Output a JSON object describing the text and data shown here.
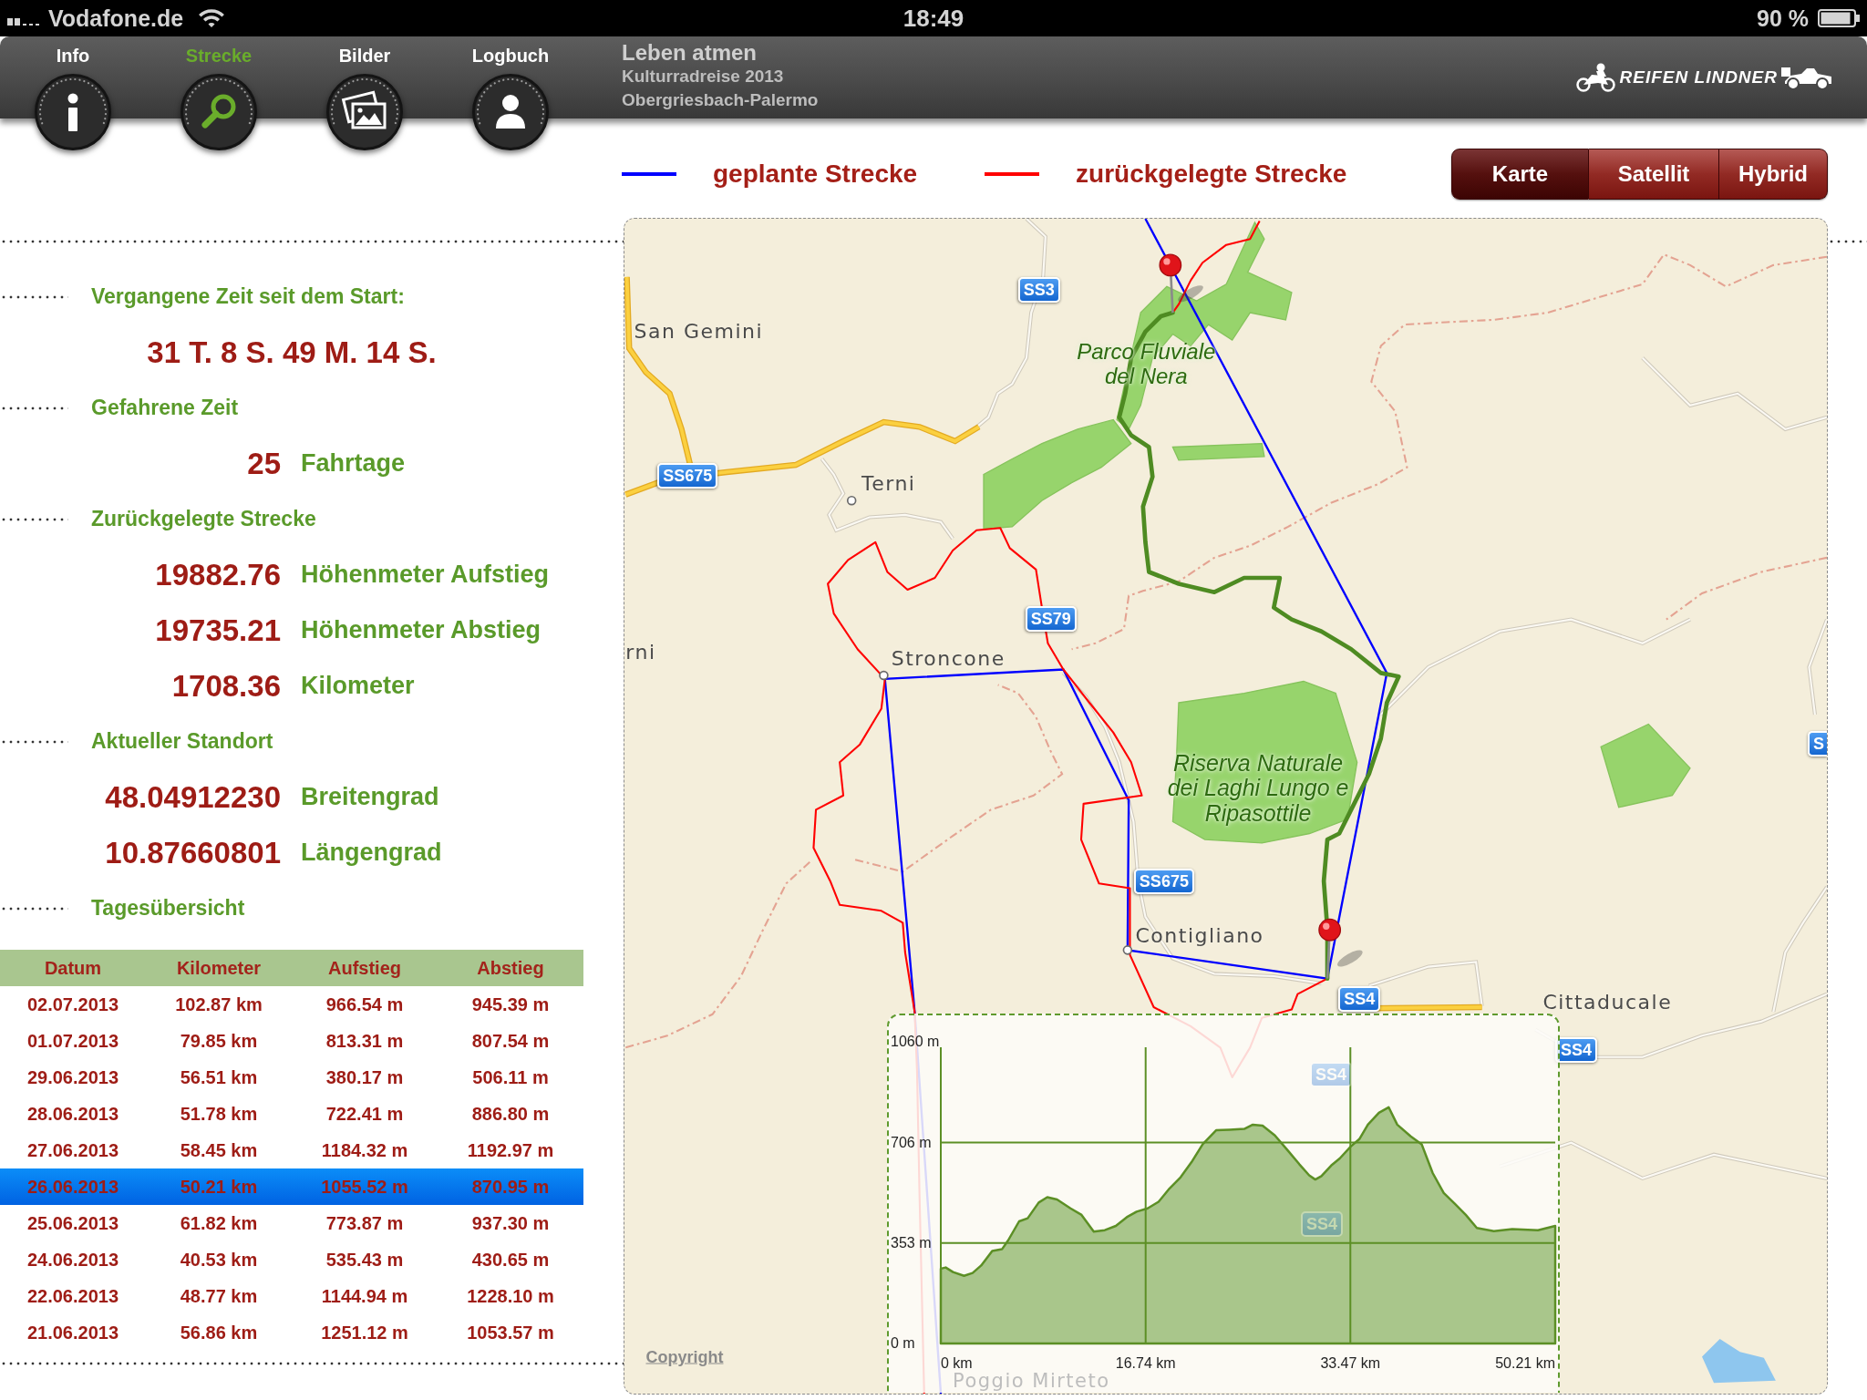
{
  "status_bar": {
    "carrier": "Vodafone.de",
    "time": "18:49",
    "battery": "90 %"
  },
  "nav": {
    "tabs": [
      {
        "label": "Info",
        "kind": "info",
        "selected": false
      },
      {
        "label": "Strecke",
        "kind": "route",
        "selected": true
      },
      {
        "label": "Bilder",
        "kind": "pictures",
        "selected": false
      },
      {
        "label": "Logbuch",
        "kind": "logbook",
        "selected": false
      }
    ],
    "title": "Leben atmen",
    "subtitle": "Kulturradreise 2013",
    "route": "Obergriesbach-Palermo",
    "logo": "REIFEN LINDNER"
  },
  "legend": [
    {
      "label": "geplante Strecke",
      "color": "#0000ff"
    },
    {
      "label": "zurückgelegte Strecke",
      "color": "#ff0000"
    }
  ],
  "map_type": [
    {
      "label": "Karte",
      "selected": true
    },
    {
      "label": "Satellit",
      "selected": false
    },
    {
      "label": "Hybrid",
      "selected": false
    }
  ],
  "stats": [
    {
      "heading": "Vergangene Zeit seit dem Start:",
      "rows": [
        {
          "kind": "elapsed",
          "value": "31 T. 8 S. 49 M. 14 S."
        }
      ]
    },
    {
      "heading": "Gefahrene Zeit",
      "rows": [
        {
          "kind": "stat",
          "value": "25",
          "unit": "Fahrtage"
        }
      ]
    },
    {
      "heading": "Zurückgelegte Strecke",
      "rows": [
        {
          "kind": "stat",
          "value": "19882.76",
          "unit": "Höhenmeter Aufstieg"
        },
        {
          "kind": "stat",
          "value": "19735.21",
          "unit": "Höhenmeter Abstieg"
        },
        {
          "kind": "stat",
          "value": "1708.36",
          "unit": "Kilometer"
        }
      ]
    },
    {
      "heading": "Aktueller Standort",
      "rows": [
        {
          "kind": "stat",
          "value": "48.04912230",
          "unit": "Breitengrad"
        },
        {
          "kind": "stat",
          "value": "10.87660801",
          "unit": "Längengrad"
        }
      ]
    },
    {
      "heading": "Tagesübersicht"
    }
  ],
  "table": {
    "columns": [
      "Datum",
      "Kilometer",
      "Aufstieg",
      "Abstieg"
    ],
    "rows": [
      {
        "cells": [
          "02.07.2013",
          "102.87 km",
          "966.54 m",
          "945.39 m"
        ],
        "selected": false
      },
      {
        "cells": [
          "01.07.2013",
          "79.85 km",
          "813.31 m",
          "807.54 m"
        ],
        "selected": false
      },
      {
        "cells": [
          "29.06.2013",
          "56.51 km",
          "380.17 m",
          "506.11 m"
        ],
        "selected": false
      },
      {
        "cells": [
          "28.06.2013",
          "51.78 km",
          "722.41 m",
          "886.80 m"
        ],
        "selected": false
      },
      {
        "cells": [
          "27.06.2013",
          "58.45 km",
          "1184.32 m",
          "1192.97 m"
        ],
        "selected": false
      },
      {
        "cells": [
          "26.06.2013",
          "50.21 km",
          "1055.52 m",
          "870.95 m"
        ],
        "selected": true
      },
      {
        "cells": [
          "25.06.2013",
          "61.82 km",
          "773.87 m",
          "937.30 m"
        ],
        "selected": false
      },
      {
        "cells": [
          "24.06.2013",
          "40.53 km",
          "535.43 m",
          "430.65 m"
        ],
        "selected": false
      },
      {
        "cells": [
          "22.06.2013",
          "48.77 km",
          "1144.94 m",
          "1228.10 m"
        ],
        "selected": false
      },
      {
        "cells": [
          "21.06.2013",
          "56.86 km",
          "1251.12 m",
          "1053.57 m"
        ],
        "selected": false
      }
    ]
  },
  "map": {
    "places": [
      "San Gemini",
      "Terni",
      "rni",
      "Stroncone",
      "Contigliano",
      "Cittaducale"
    ],
    "parks": [
      "Parco Fluviale del Nera",
      "Riserva Naturale dei Laghi Lungo e Ripasottile"
    ],
    "road_badges": [
      "SS3",
      "SS675",
      "SS79",
      "SS675",
      "SS4",
      "SS4",
      "S"
    ],
    "faded_labels": [
      {
        "kind": "badge",
        "text": "SS4"
      },
      {
        "kind": "badge",
        "text": "SS4"
      },
      {
        "kind": "place",
        "text": "Poggio Mirteto"
      }
    ],
    "copyright": "Copyright",
    "elevation_profile": {
      "chart_data": {
        "type": "area",
        "x": [
          0,
          0.4,
          1,
          1.9,
          2.6,
          3.3,
          4.2,
          5,
          5.5,
          6.4,
          7.1,
          8,
          8.7,
          9.5,
          10.6,
          11.5,
          12.5,
          13.4,
          14.3,
          15.2,
          16,
          16.9,
          17.8,
          18.7,
          19.6,
          20.5,
          21.4,
          22.5,
          23.6,
          24.8,
          25.5,
          26.3,
          27.3,
          28.4,
          29.3,
          30.1,
          30.6,
          31.1,
          31.9,
          32.6,
          33.5,
          34.2,
          34.9,
          35.8,
          36.6,
          37.3,
          38.4,
          39.3,
          40.2,
          41.1,
          42,
          42.9,
          43.8,
          45.2,
          46.7,
          48.8,
          50.21
        ],
        "values": [
          263,
          267,
          251,
          238,
          248,
          274,
          325,
          331,
          362,
          429,
          440,
          495,
          514,
          506,
          475,
          452,
          393,
          398,
          413,
          444,
          463,
          475,
          498,
          545,
          584,
          638,
          700,
          749,
          751,
          754,
          769,
          765,
          731,
          676,
          630,
          591,
          576,
          588,
          625,
          650,
          692,
          718,
          769,
          811,
          830,
          769,
          728,
          700,
          599,
          529,
          491,
          452,
          406,
          395,
          402,
          398,
          413
        ],
        "xlim": [
          0,
          50.21
        ],
        "ylim": [
          0,
          1060
        ],
        "xticks": [
          {
            "value": 0,
            "label": "0 km"
          },
          {
            "value": 16.74,
            "label": "16.74 km"
          },
          {
            "value": 33.47,
            "label": "33.47 km"
          },
          {
            "value": 50.21,
            "label": "50.21 km"
          }
        ],
        "yticks": [
          {
            "value": 0,
            "label": "0 m"
          },
          {
            "value": 353,
            "label": "353 m"
          },
          {
            "value": 706,
            "label": "706 m"
          },
          {
            "value": 1060,
            "label": "1060 m"
          }
        ],
        "grid": true
      }
    }
  }
}
